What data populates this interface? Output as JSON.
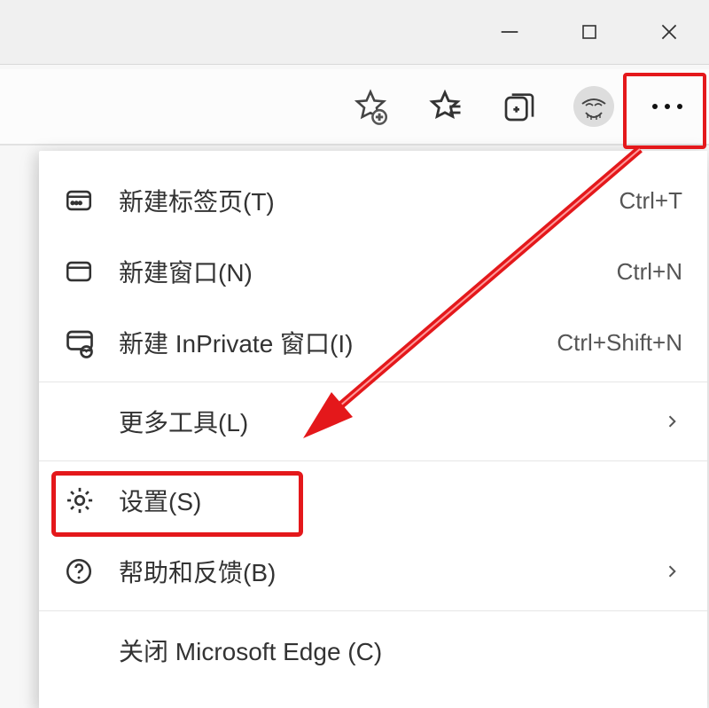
{
  "window": {
    "minimize_icon": "minimize",
    "maximize_icon": "maximize",
    "close_icon": "close"
  },
  "toolbar": {
    "add_favorite_icon": "star-add",
    "favorites_icon": "star-list",
    "collections_icon": "collections",
    "profile_icon": "avatar",
    "more_icon": "more"
  },
  "menu": {
    "items": [
      {
        "key": "new-tab",
        "icon": "tab",
        "label": "新建标签页(T)",
        "shortcut": "Ctrl+T",
        "submenu": false
      },
      {
        "key": "new-window",
        "icon": "window",
        "label": "新建窗口(N)",
        "shortcut": "Ctrl+N",
        "submenu": false
      },
      {
        "key": "new-inprivate",
        "icon": "inprivate",
        "label": "新建 InPrivate 窗口(I)",
        "shortcut": "Ctrl+Shift+N",
        "submenu": false
      }
    ],
    "more_tools": {
      "key": "more-tools",
      "label": "更多工具(L)",
      "submenu": true
    },
    "settings": {
      "key": "settings",
      "icon": "gear",
      "label": "设置(S)",
      "submenu": false
    },
    "help": {
      "key": "help",
      "icon": "help",
      "label": "帮助和反馈(B)",
      "submenu": true
    },
    "close_app": {
      "key": "close-app",
      "label": "关闭 Microsoft Edge (C)",
      "submenu": false
    }
  },
  "annotations": {
    "more_button_highlight": true,
    "settings_highlight": true,
    "arrow_from_more_to_settings": true,
    "highlight_color": "#e4181b"
  }
}
